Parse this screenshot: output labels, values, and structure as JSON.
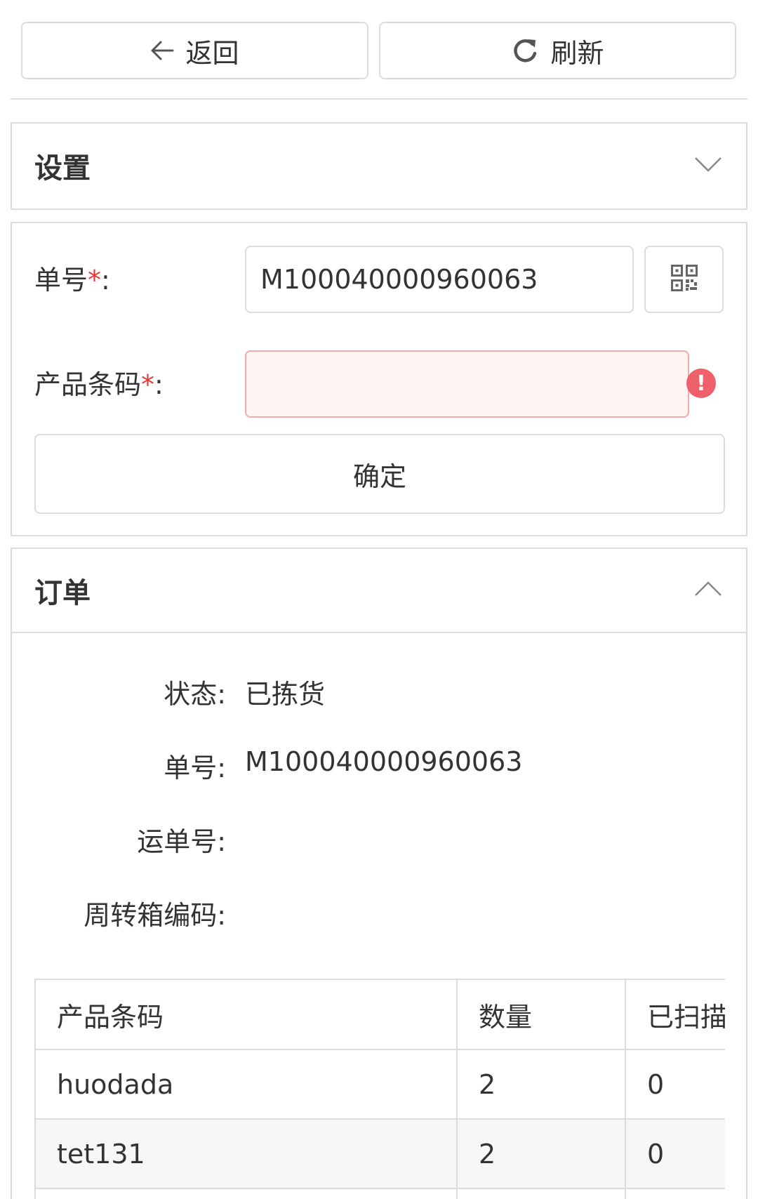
{
  "toolbar": {
    "back_label": "返回",
    "refresh_label": "刷新"
  },
  "settings_panel": {
    "title": "设置"
  },
  "form": {
    "order_no_label": "单号",
    "order_no_value": "M100040000960063",
    "barcode_label": "产品条码",
    "barcode_value": "",
    "required_mark": "*",
    "colon": ":",
    "confirm_label": "确定"
  },
  "order_panel": {
    "title": "订单",
    "fields": [
      {
        "label": "状态:",
        "value": "已拣货"
      },
      {
        "label": "单号:",
        "value": "M100040000960063"
      },
      {
        "label": "运单号:",
        "value": ""
      },
      {
        "label": "周转箱编码:",
        "value": ""
      }
    ],
    "table": {
      "headers": [
        "产品条码",
        "数量",
        "已扫描"
      ],
      "rows": [
        [
          "huodada",
          "2",
          "0"
        ],
        [
          "tet131",
          "2",
          "0"
        ],
        [
          "",
          "",
          ""
        ]
      ]
    }
  },
  "colors": {
    "required": "#e53935",
    "error_icon": "#f0606a",
    "error_input_bg": "#fff4f4",
    "error_input_border": "#f2aaaa",
    "border": "#dcdcdc"
  }
}
